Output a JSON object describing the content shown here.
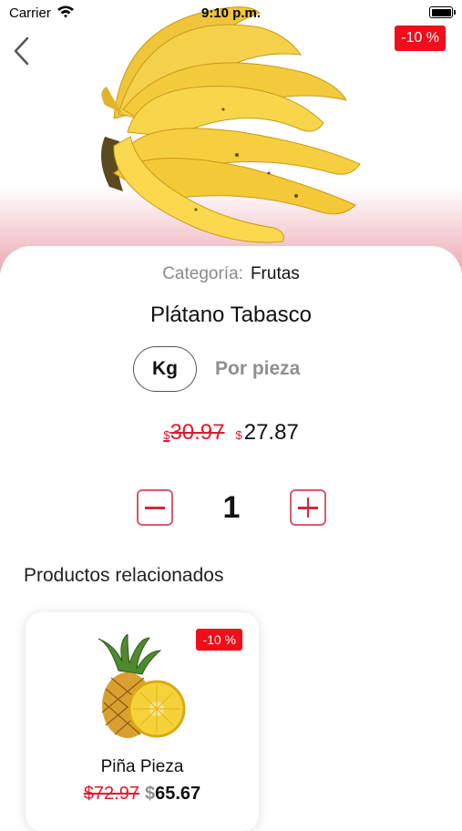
{
  "status_bar": {
    "carrier": "Carrier",
    "time": "9:10 p.m."
  },
  "product": {
    "discount_badge": "-10 %",
    "category_label": "Categoría:",
    "category_value": "Frutas",
    "name": "Plátano Tabasco",
    "image_icon": "banana-image",
    "units": [
      {
        "label": "Kg",
        "selected": true
      },
      {
        "label": "Por pieza",
        "selected": false
      }
    ],
    "currency_symbol": "$",
    "old_price": "30.97",
    "new_price": "27.87",
    "quantity": "1"
  },
  "related": {
    "title": "Productos relacionados",
    "items": [
      {
        "name": "Piña Pieza",
        "discount_badge": "-10 %",
        "old_price": "$72.97",
        "currency_symbol": "$",
        "new_price": "65.67",
        "image_icon": "pineapple-image"
      }
    ]
  },
  "colors": {
    "accent_red": "#f20d1a",
    "price_red": "#e3182c",
    "stepper_border": "#d95b69"
  }
}
